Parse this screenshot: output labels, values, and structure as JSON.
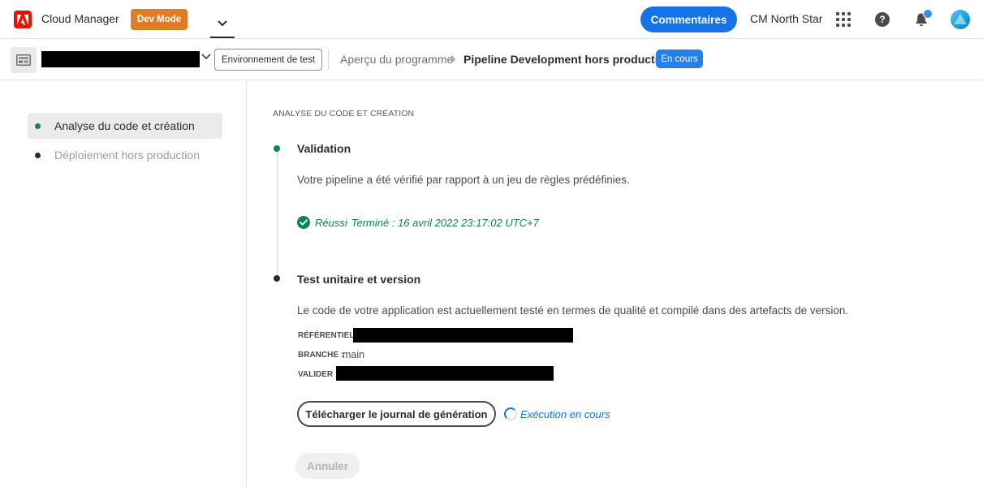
{
  "header": {
    "app_name": "Cloud Manager",
    "dev_mode_label": "Dev Mode",
    "comments_label": "Commentaires",
    "org_name": "CM North Star",
    "help_glyph": "?"
  },
  "subbar": {
    "environment_button": "Environnement de test",
    "breadcrumb_program": "Aperçu du programme",
    "breadcrumb_current": "Pipeline Development hors production",
    "status_badge": "En cours"
  },
  "sidebar": {
    "items": [
      {
        "label": "Analyse du code et création",
        "state": "active",
        "dot_color": "#12805c"
      },
      {
        "label": "Déploiement hors production",
        "state": "inactive",
        "dot_color": "#2c2c2c"
      }
    ]
  },
  "main": {
    "section_heading": "ANALYSE DU CODE ET CRÉATION",
    "steps": [
      {
        "title": "Validation",
        "description": "Votre pipeline a été vérifié par rapport à un jeu de règles prédéfinies.",
        "status": "Réussi",
        "completed_text": "Terminé : 16 avril 2022 23:17:02 UTC+7",
        "dot_color": "#12805c"
      },
      {
        "title": "Test unitaire et version",
        "description": "Le code de votre application est actuellement testé en termes de qualité et compilé dans des artefacts de version.",
        "repository_label": "RÉFÉRENTIEL :",
        "branch_label": "BRANCHE :",
        "branch_value": "main",
        "commit_label": "VALIDER :",
        "dot_color": "#2c2c2c"
      }
    ],
    "download_button": "Télécharger le journal de génération",
    "running_text": "Exécution en cours",
    "cancel_button": "Annuler"
  },
  "colors": {
    "accent_blue": "#1473e6",
    "success_green": "#12805c",
    "dev_mode_orange": "#e07c24",
    "adobe_red": "#eb1000"
  }
}
